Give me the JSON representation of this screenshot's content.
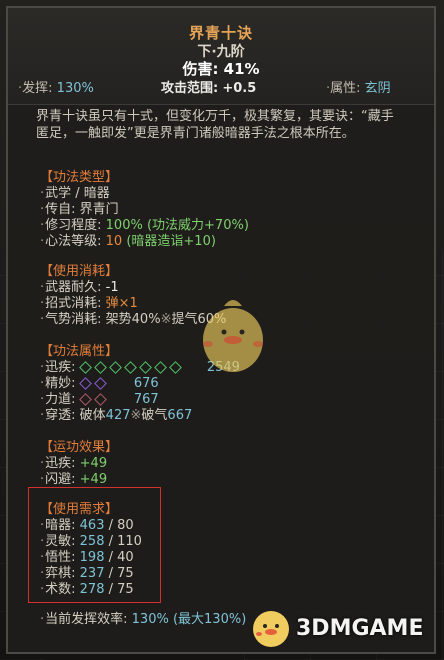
{
  "header": {
    "title": "界青十诀",
    "tier": "下·九阶",
    "damage": "伤害: 41%",
    "attack_range_label": "攻击范围:",
    "attack_range_value": "+0.5",
    "fahui_label": "发挥:",
    "fahui_value": "130%",
    "attr_label": "属性:",
    "attr_value": "玄阴"
  },
  "description": "界青十诀虽只有十式，但变化万千，极其繁复，其要诀：“藏手匿足，一触即发”更是界青门诸般暗器手法之根本所在。",
  "gongfa_type": {
    "title": "【功法类型】",
    "lines": [
      {
        "label": "武学 / 暗器",
        "value": ""
      },
      {
        "label": "传自: 界青门",
        "value": ""
      }
    ],
    "xiuxi_label": "修习程度: ",
    "xiuxi_value": "100%",
    "xiuxi_extra": "(功法威力+70%)",
    "xinfa_label": "心法等级: ",
    "xinfa_value": "10",
    "xinfa_extra": "(暗器造诣+10)"
  },
  "consumption": {
    "title": "【使用消耗】",
    "weapon_label": "武器耐久: ",
    "weapon_value": "-1",
    "zhaoshi_label": "招式消耗: ",
    "zhaoshi_value": "弹×1",
    "qishi_label": "气势消耗: ",
    "qishi_value_a": "架势40%",
    "qishi_sep": "※",
    "qishi_value_b": "提气60%"
  },
  "properties": {
    "title": "【功法属性】",
    "xunji_label": "迅疾:",
    "xunji_value": "2549",
    "jingmiao_label": "精妙:",
    "jingmiao_value": "676",
    "lidao_label": "力道:",
    "lidao_value": "767",
    "chuantou_label": "穿透: ",
    "chuantou_a_label": "破体",
    "chuantou_a_value": "427",
    "chuantou_sep": "※",
    "chuantou_b_label": "破气",
    "chuantou_b_value": "667"
  },
  "effects": {
    "title": "【运功效果】",
    "xunji_label": "迅疾: ",
    "xunji_value": "+49",
    "shanbi_label": "闪避: ",
    "shanbi_value": "+49"
  },
  "requirements": {
    "title": "【使用需求】",
    "rows": [
      {
        "label": "暗器: ",
        "cur": "463",
        "req": "80"
      },
      {
        "label": "灵敏: ",
        "cur": "258",
        "req": "110"
      },
      {
        "label": "悟性: ",
        "cur": "198",
        "req": "40"
      },
      {
        "label": "弈棋: ",
        "cur": "237",
        "req": "75"
      },
      {
        "label": "术数: ",
        "cur": "278",
        "req": "75"
      }
    ],
    "sep": " / "
  },
  "footer": {
    "label": "当前发挥效率: ",
    "value": "130%",
    "extra": "(最大130%)"
  },
  "watermark": {
    "text": "3DMGAME"
  },
  "colors": {
    "title": "#e6a457",
    "section": "#e37d3a",
    "green": "#7fd06e",
    "cyan": "#7fc3d6",
    "orange": "#e58a3e",
    "highlight_box": "#d0312c"
  }
}
